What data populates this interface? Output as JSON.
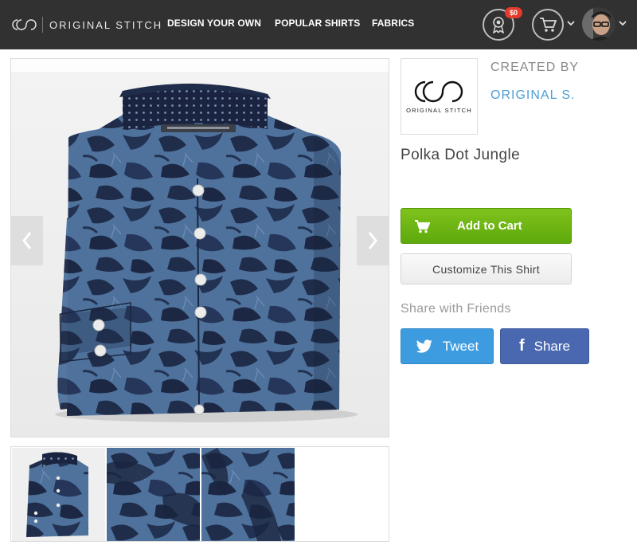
{
  "brand": {
    "name": "ORIGINAL STITCH",
    "logo_icon": "oso-logo-icon"
  },
  "nav": {
    "links": [
      "DESIGN YOUR OWN",
      "POPULAR SHIRTS",
      "FABRICS"
    ],
    "credit_badge": "$0"
  },
  "product": {
    "title": "Polka Dot Jungle",
    "image_alt": "Folded navy shirt with dark tropical leaf print and polka dot collar lining"
  },
  "creator": {
    "label": "CREATED BY",
    "name": "ORIGINAL S.",
    "logo_text": "ORIGINAL STITCH"
  },
  "actions": {
    "add_to_cart": "Add to Cart",
    "customize": "Customize This Shirt"
  },
  "share": {
    "label": "Share with Friends",
    "tweet": "Tweet",
    "facebook": "Share"
  },
  "colors": {
    "nav_bg": "#313131",
    "cart_green": "#6cb514",
    "twitter_blue": "#3d9be0",
    "facebook_blue": "#4a68b0",
    "creator_link": "#4d9ed6",
    "badge_red": "#e53b2c",
    "shirt_base": "#4d6f99",
    "shirt_print": "#1c2a45"
  },
  "thumbnails": [
    "shirt-front-thumb",
    "fabric-detail-thumb-1",
    "fabric-detail-thumb-2"
  ]
}
